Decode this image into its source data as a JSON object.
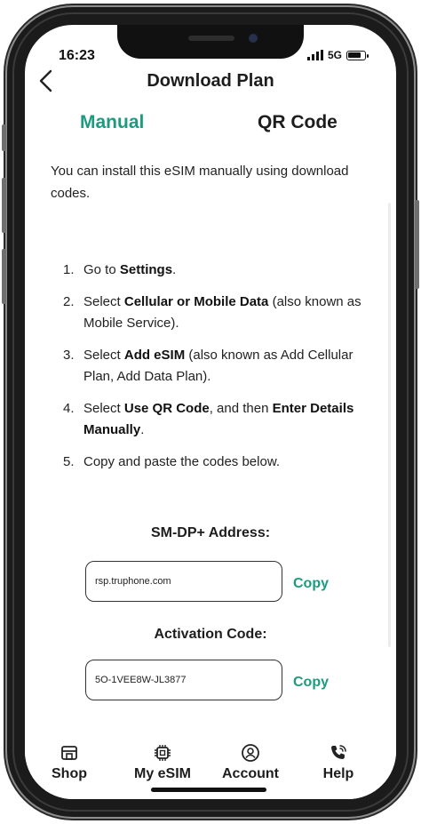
{
  "status": {
    "time": "16:23",
    "network": "5G"
  },
  "header": {
    "title": "Download Plan"
  },
  "tabs": [
    {
      "label": "Manual",
      "active": true
    },
    {
      "label": "QR Code",
      "active": false
    }
  ],
  "intro": "You can install this eSIM manually using download codes.",
  "steps": [
    {
      "n": "1.",
      "a": "Go to ",
      "b": "Settings",
      "c": "."
    },
    {
      "n": "2.",
      "a": "Select ",
      "b": "Cellular or Mobile Data",
      "c": " (also known as Mobile Service)."
    },
    {
      "n": "3.",
      "a": "Select ",
      "b": "Add eSIM",
      "c": " (also known as Add Cellular Plan, Add Data Plan)."
    },
    {
      "n": "4.",
      "a": "Select ",
      "b": "Use QR Code",
      "c": ", and then ",
      "d": "Enter Details Manually",
      "e": "."
    },
    {
      "n": "5.",
      "a": "Copy and paste the codes below."
    }
  ],
  "smdp": {
    "label": "SM-DP+ Address:",
    "value": "rsp.truphone.com",
    "copy_label": "Copy"
  },
  "activation": {
    "label": "Activation Code:",
    "value": "5O-1VEE8W-JL3877",
    "copy_label": "Copy"
  },
  "bottom_nav": [
    {
      "label": "Shop",
      "icon": "shop-icon"
    },
    {
      "label": "My eSIM",
      "icon": "chip-icon"
    },
    {
      "label": "Account",
      "icon": "account-icon"
    },
    {
      "label": "Help",
      "icon": "phone-icon"
    }
  ],
  "colors": {
    "accent": "#1e9a80",
    "text": "#1d1d1d"
  }
}
